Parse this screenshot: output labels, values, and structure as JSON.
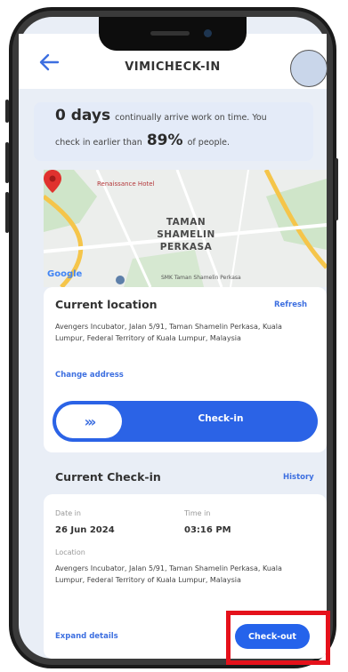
{
  "header": {
    "title": "VIMICHECK-IN"
  },
  "stats": {
    "days_value": "0 days",
    "days_text": "continually arrive work on time. You",
    "percent_prefix": "check in earlier than",
    "percent_value": "89%",
    "percent_suffix": "of people."
  },
  "map": {
    "hotel_label": "Renaissance Hotel",
    "area_line1": "TAMAN",
    "area_line2": "SHAMELIN",
    "area_line3": "PERKASA",
    "google_label": "Google",
    "poi_label": "SMK Taman Shamelin Perkasa"
  },
  "location": {
    "title": "Current location",
    "refresh_label": "Refresh",
    "address": "Avengers Incubator, Jalan 5/91, Taman Shamelin Perkasa, Kuala Lumpur, Federal Territory of Kuala Lumpur, Malaysia",
    "change_address_label": "Change address"
  },
  "slider": {
    "label": "Check-in",
    "knob_glyph": "›››"
  },
  "checkin": {
    "title": "Current Check-in",
    "history_label": "History",
    "date_label": "Date in",
    "date_value": "26 Jun 2024",
    "time_label": "Time in",
    "time_value": "03:16 PM",
    "location_label": "Location",
    "location_value": "Avengers Incubator, Jalan 5/91, Taman Shamelin Perkasa, Kuala Lumpur, Federal Territory of Kuala Lumpur, Malaysia",
    "expand_label": "Expand details",
    "checkout_label": "Check-out"
  },
  "colors": {
    "accent": "#2563eb",
    "highlight": "#e5111b",
    "map_pin": "#e0322e"
  }
}
